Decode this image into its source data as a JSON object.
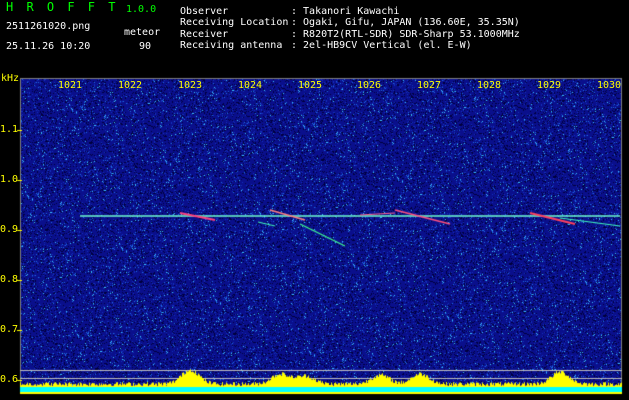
{
  "app": {
    "name": "H R O F F T",
    "version": "1.0.0",
    "filename": "2511261020.png",
    "timestamp": "25.11.26 10:20",
    "mode_label": "meteor",
    "mode_value": "90"
  },
  "info": {
    "rows": [
      {
        "label": "Observer",
        "value": ": Takanori Kawachi"
      },
      {
        "label": "Receiving Location",
        "value": ": Ogaki, Gifu, JAPAN (136.60E, 35.35N)"
      },
      {
        "label": "Receiver",
        "value": ": R820T2(RTL-SDR) SDR-Sharp 53.1000MHz"
      },
      {
        "label": "Receiving antenna",
        "value": ": 2el-HB9CV Vertical (el. E-W)"
      }
    ]
  },
  "axis": {
    "y_unit": "kHz",
    "y_ticks": [
      "1.1",
      "1.0",
      "0.9",
      "0.8",
      "0.7",
      "0.6"
    ],
    "x_ticks": [
      "1021",
      "1022",
      "1023",
      "1024",
      "1025",
      "1026",
      "1027",
      "1028",
      "1029",
      "1030"
    ]
  },
  "colors": {
    "background": "#000000",
    "noise_base": "#0a0f8c",
    "carrier": "#6fffd0",
    "text_yellow": "#ffff00",
    "text_green": "#00ff00",
    "text_white": "#ffffff",
    "bottom_bar": "#00ffff"
  }
}
